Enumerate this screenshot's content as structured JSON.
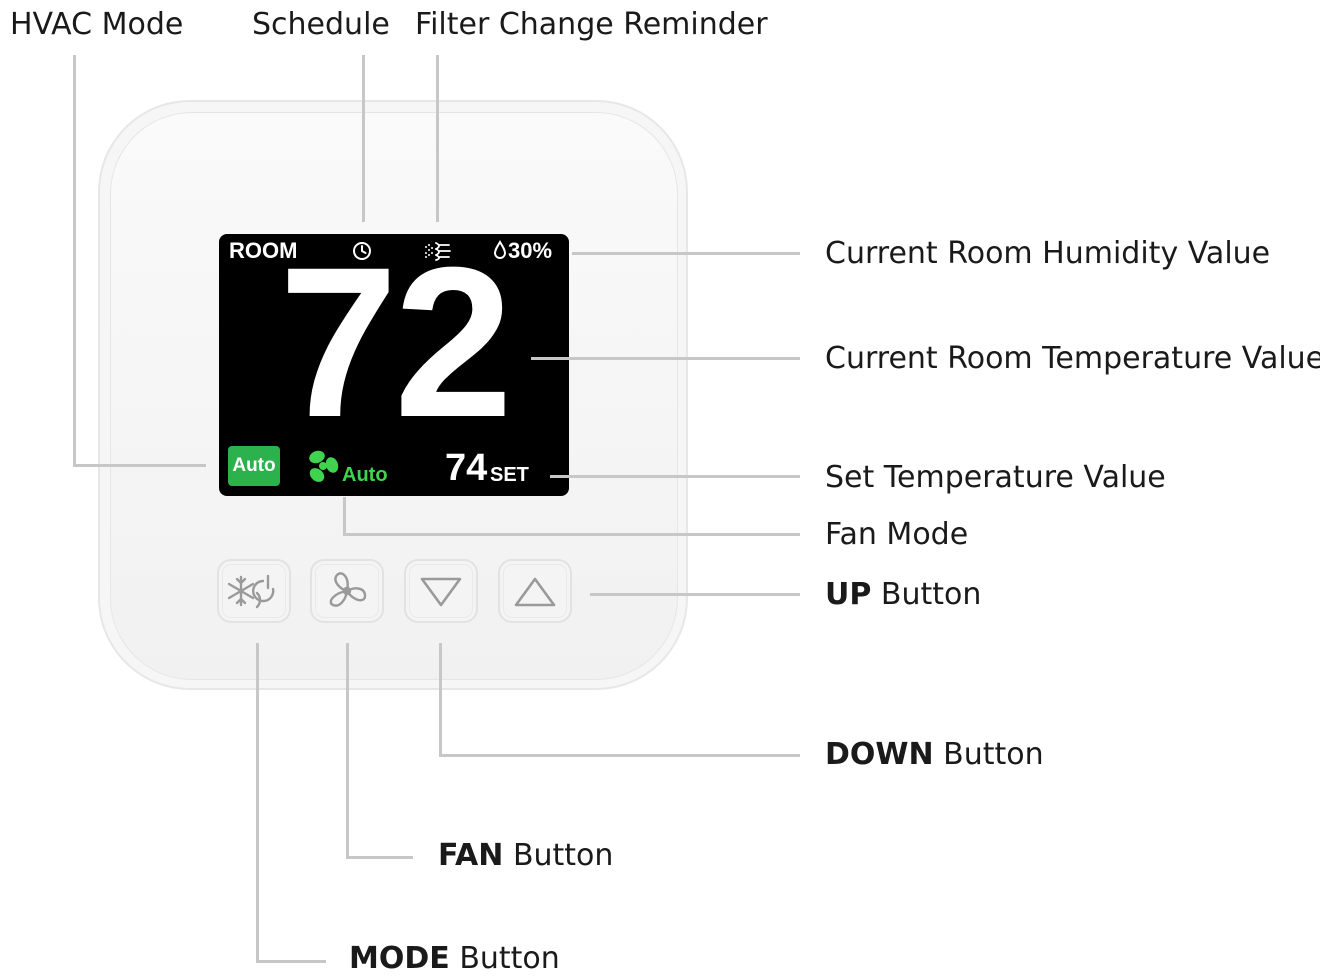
{
  "callouts": {
    "hvac_mode": "HVAC Mode",
    "schedule": "Schedule",
    "filter": "Filter Change Reminder",
    "humidity": "Current Room Humidity Value",
    "room_temp": "Current Room Temperature Value",
    "set_temp": "Set Temperature Value",
    "fan_mode": "Fan Mode",
    "up_bold": "UP",
    "up_rest": "Button",
    "down_bold": "DOWN",
    "down_rest": "Button",
    "fan_bold": "FAN",
    "fan_rest": "Button",
    "mode_bold": "MODE",
    "mode_rest": "Button"
  },
  "screen": {
    "room_label": "ROOM",
    "humidity": "30%",
    "temperature": "72",
    "hvac_mode": "Auto",
    "fan_mode": "Auto",
    "set_value": "74",
    "set_label": "SET"
  },
  "icons": {
    "schedule": "clock-icon",
    "filter": "filter-icon",
    "humidity": "droplet-icon",
    "fan": "fan-icon",
    "mode_button": "snowflake-power-icon",
    "fan_button": "fan-outline-icon",
    "down_button": "triangle-down-icon",
    "up_button": "triangle-up-icon"
  },
  "colors": {
    "screen_bg": "#000000",
    "hvac_badge": "#2bb24c",
    "fan_green": "#3fd34f",
    "leader_line": "#c7c7c7"
  }
}
